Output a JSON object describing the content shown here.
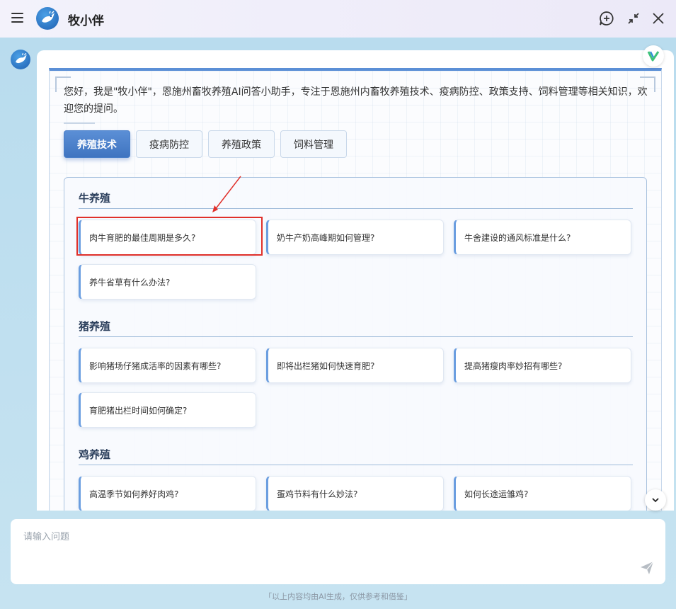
{
  "header": {
    "title": "牧小伴",
    "menu_icon": "hamburger-menu-icon",
    "new_chat_icon": "add-chat-icon",
    "minimize_icon": "collapse-icon",
    "close_icon": "close-icon"
  },
  "message": {
    "greeting": "您好，我是\"牧小伴\"，恩施州畜牧养殖AI问答小助手，专注于恩施州内畜牧养殖技术、疫病防控、政策支持、饲料管理等相关知识，欢迎您的提问。",
    "tabs": [
      "养殖技术",
      "疫病防控",
      "养殖政策",
      "饲料管理"
    ],
    "active_tab": "养殖技术",
    "sections": [
      {
        "title": "牛养殖",
        "questions": [
          "肉牛育肥的最佳周期是多久?",
          "奶牛产奶高峰期如何管理?",
          "牛舍建设的通风标准是什么?",
          "养牛省草有什么办法?"
        ]
      },
      {
        "title": "猪养殖",
        "questions": [
          "影响猪场仔猪成活率的因素有哪些?",
          "即将出栏猪如何快速育肥?",
          "提高猪瘦肉率妙招有哪些?",
          "育肥猪出栏时间如何确定?"
        ]
      },
      {
        "title": "鸡养殖",
        "questions": [
          "高温季节如何养好肉鸡?",
          "蛋鸡节料有什么妙法?",
          "如何长途运雏鸡?"
        ]
      }
    ]
  },
  "input": {
    "placeholder": "请输入问题"
  },
  "footer": {
    "note": "「以上内容均由AI生成，仅供参考和借鉴」"
  },
  "colors": {
    "accent": "#4a7fc9",
    "highlight": "#e0302a",
    "background": "#c6e3f1"
  }
}
